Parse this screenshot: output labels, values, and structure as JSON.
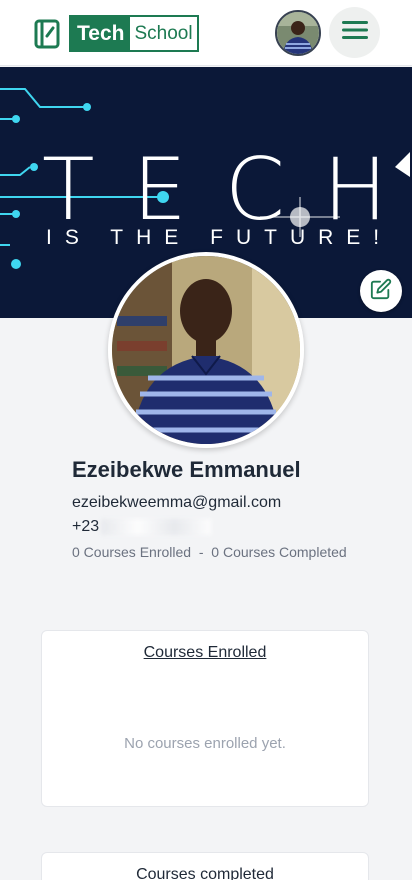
{
  "header": {
    "logo_tech": "Tech",
    "logo_school": "School"
  },
  "banner": {
    "title": "TECH",
    "subtitle": "IS THE FUTURE!"
  },
  "profile": {
    "name": "Ezeibekwe Emmanuel",
    "email": "ezeibekweemma@gmail.com",
    "phone_prefix": "+23",
    "courses_enrolled_count": "0 Courses Enrolled",
    "separator": "-",
    "courses_completed_count": "0 Courses Completed"
  },
  "cards": {
    "enrolled": {
      "title": "Courses Enrolled",
      "empty_message": "No courses enrolled yet."
    },
    "completed": {
      "title": "Courses completed"
    }
  },
  "colors": {
    "brand_green": "#1d7a52",
    "banner_bg": "#0b1838",
    "circuit_cyan": "#3fd6f0"
  },
  "icons": {
    "menu": "hamburger-menu-icon",
    "edit": "edit-pencil-icon",
    "logo": "book-logo-icon"
  }
}
